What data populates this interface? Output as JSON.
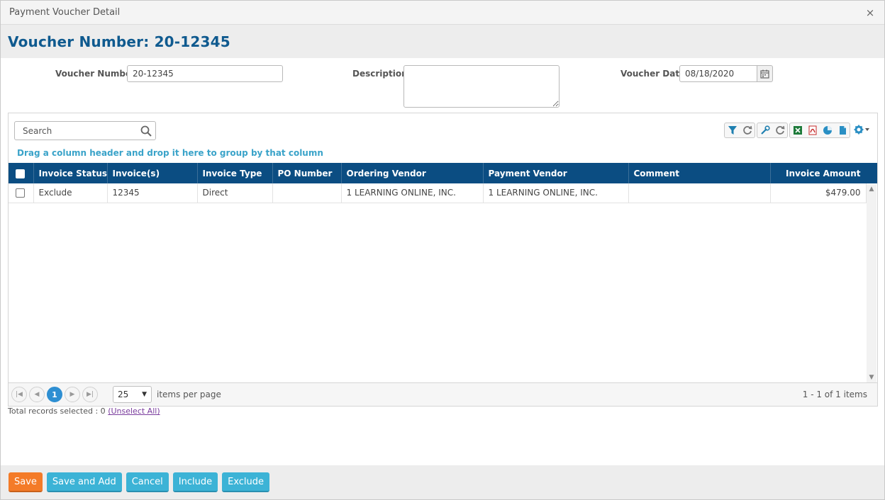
{
  "dialog": {
    "title": "Payment Voucher Detail",
    "close_glyph": "×"
  },
  "heading": "Voucher Number: 20-12345",
  "form": {
    "voucher_number_label": "Voucher Number:",
    "voucher_number_value": "20-12345",
    "description_label": "Description:",
    "description_value": "",
    "voucher_date_label": "Voucher Date:",
    "voucher_date_value": "08/18/2020"
  },
  "grid": {
    "search_placeholder": "Search",
    "group_hint": "Drag a column header and drop it here to group by that column",
    "toolbar_icons": [
      "filter-icon",
      "reset-filter-icon",
      "wrench-icon",
      "reset-layout-icon",
      "excel-icon",
      "pdf-icon",
      "chart-icon",
      "document-icon",
      "settings-gear-icon"
    ],
    "columns": [
      "Invoice Status",
      "Invoice(s)",
      "Invoice Type",
      "PO Number",
      "Ordering Vendor",
      "Payment Vendor",
      "Comment",
      "Invoice Amount"
    ],
    "rows": [
      {
        "status": "Exclude",
        "invoice": "12345",
        "type": "Direct",
        "po": "",
        "ordering_vendor": "1 LEARNING ONLINE, INC.",
        "payment_vendor": "1 LEARNING ONLINE, INC.",
        "comment": "",
        "amount": "$479.00"
      }
    ],
    "pager": {
      "current_page": "1",
      "page_size": "25",
      "items_per_page_label": "items per page",
      "info": "1 - 1 of 1 items"
    }
  },
  "selection": {
    "text": "Total records selected : 0",
    "unselect_link": "(Unselect All)"
  },
  "footer": {
    "save": "Save",
    "save_and_add": "Save and Add",
    "cancel": "Cancel",
    "include": "Include",
    "exclude": "Exclude"
  },
  "colors": {
    "header_blue": "#0b4d82",
    "heading_blue": "#0f5a8f",
    "accent_orange": "#f47b28",
    "accent_cyan": "#3cb3d6",
    "hint_cyan": "#3aa3c9"
  }
}
